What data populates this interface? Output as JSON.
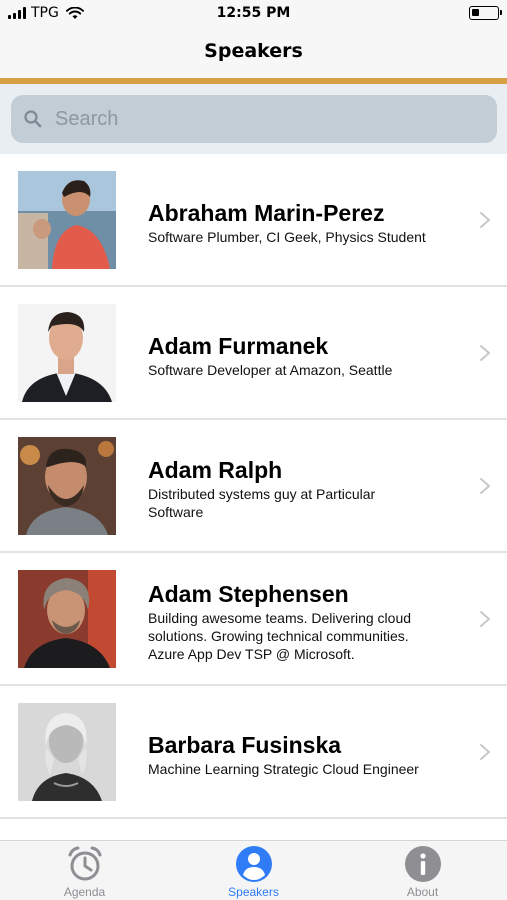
{
  "status_bar": {
    "carrier": "TPG",
    "time": "12:55 PM",
    "battery_level": 0.3
  },
  "nav": {
    "title": "Speakers"
  },
  "search": {
    "placeholder": "Search",
    "value": ""
  },
  "speakers": [
    {
      "name": "Abraham Marin-Perez",
      "bio_lines": [
        "Software Plumber, CI Geek, Physics Student"
      ]
    },
    {
      "name": "Adam Furmanek",
      "bio_lines": [
        "Software Developer at Amazon, Seattle"
      ]
    },
    {
      "name": "Adam Ralph",
      "bio_lines": [
        "Distributed systems guy at Particular",
        "Software"
      ]
    },
    {
      "name": "Adam Stephensen",
      "bio_lines": [
        "Building awesome teams. Delivering cloud",
        "solutions. Growing technical communities.",
        "Azure App Dev TSP @ Microsoft."
      ]
    },
    {
      "name": "Barbara Fusinska",
      "bio_lines": [
        "Machine Learning Strategic Cloud Engineer"
      ]
    }
  ],
  "tabs": [
    {
      "label": "Agenda",
      "icon": "alarm-clock-icon",
      "active": false
    },
    {
      "label": "Speakers",
      "icon": "person-icon",
      "active": true
    },
    {
      "label": "About",
      "icon": "info-icon",
      "active": false
    }
  ],
  "colors": {
    "accent": "#d7a045",
    "tab_active": "#2f7cf6",
    "tab_inactive": "#8e8e93"
  }
}
